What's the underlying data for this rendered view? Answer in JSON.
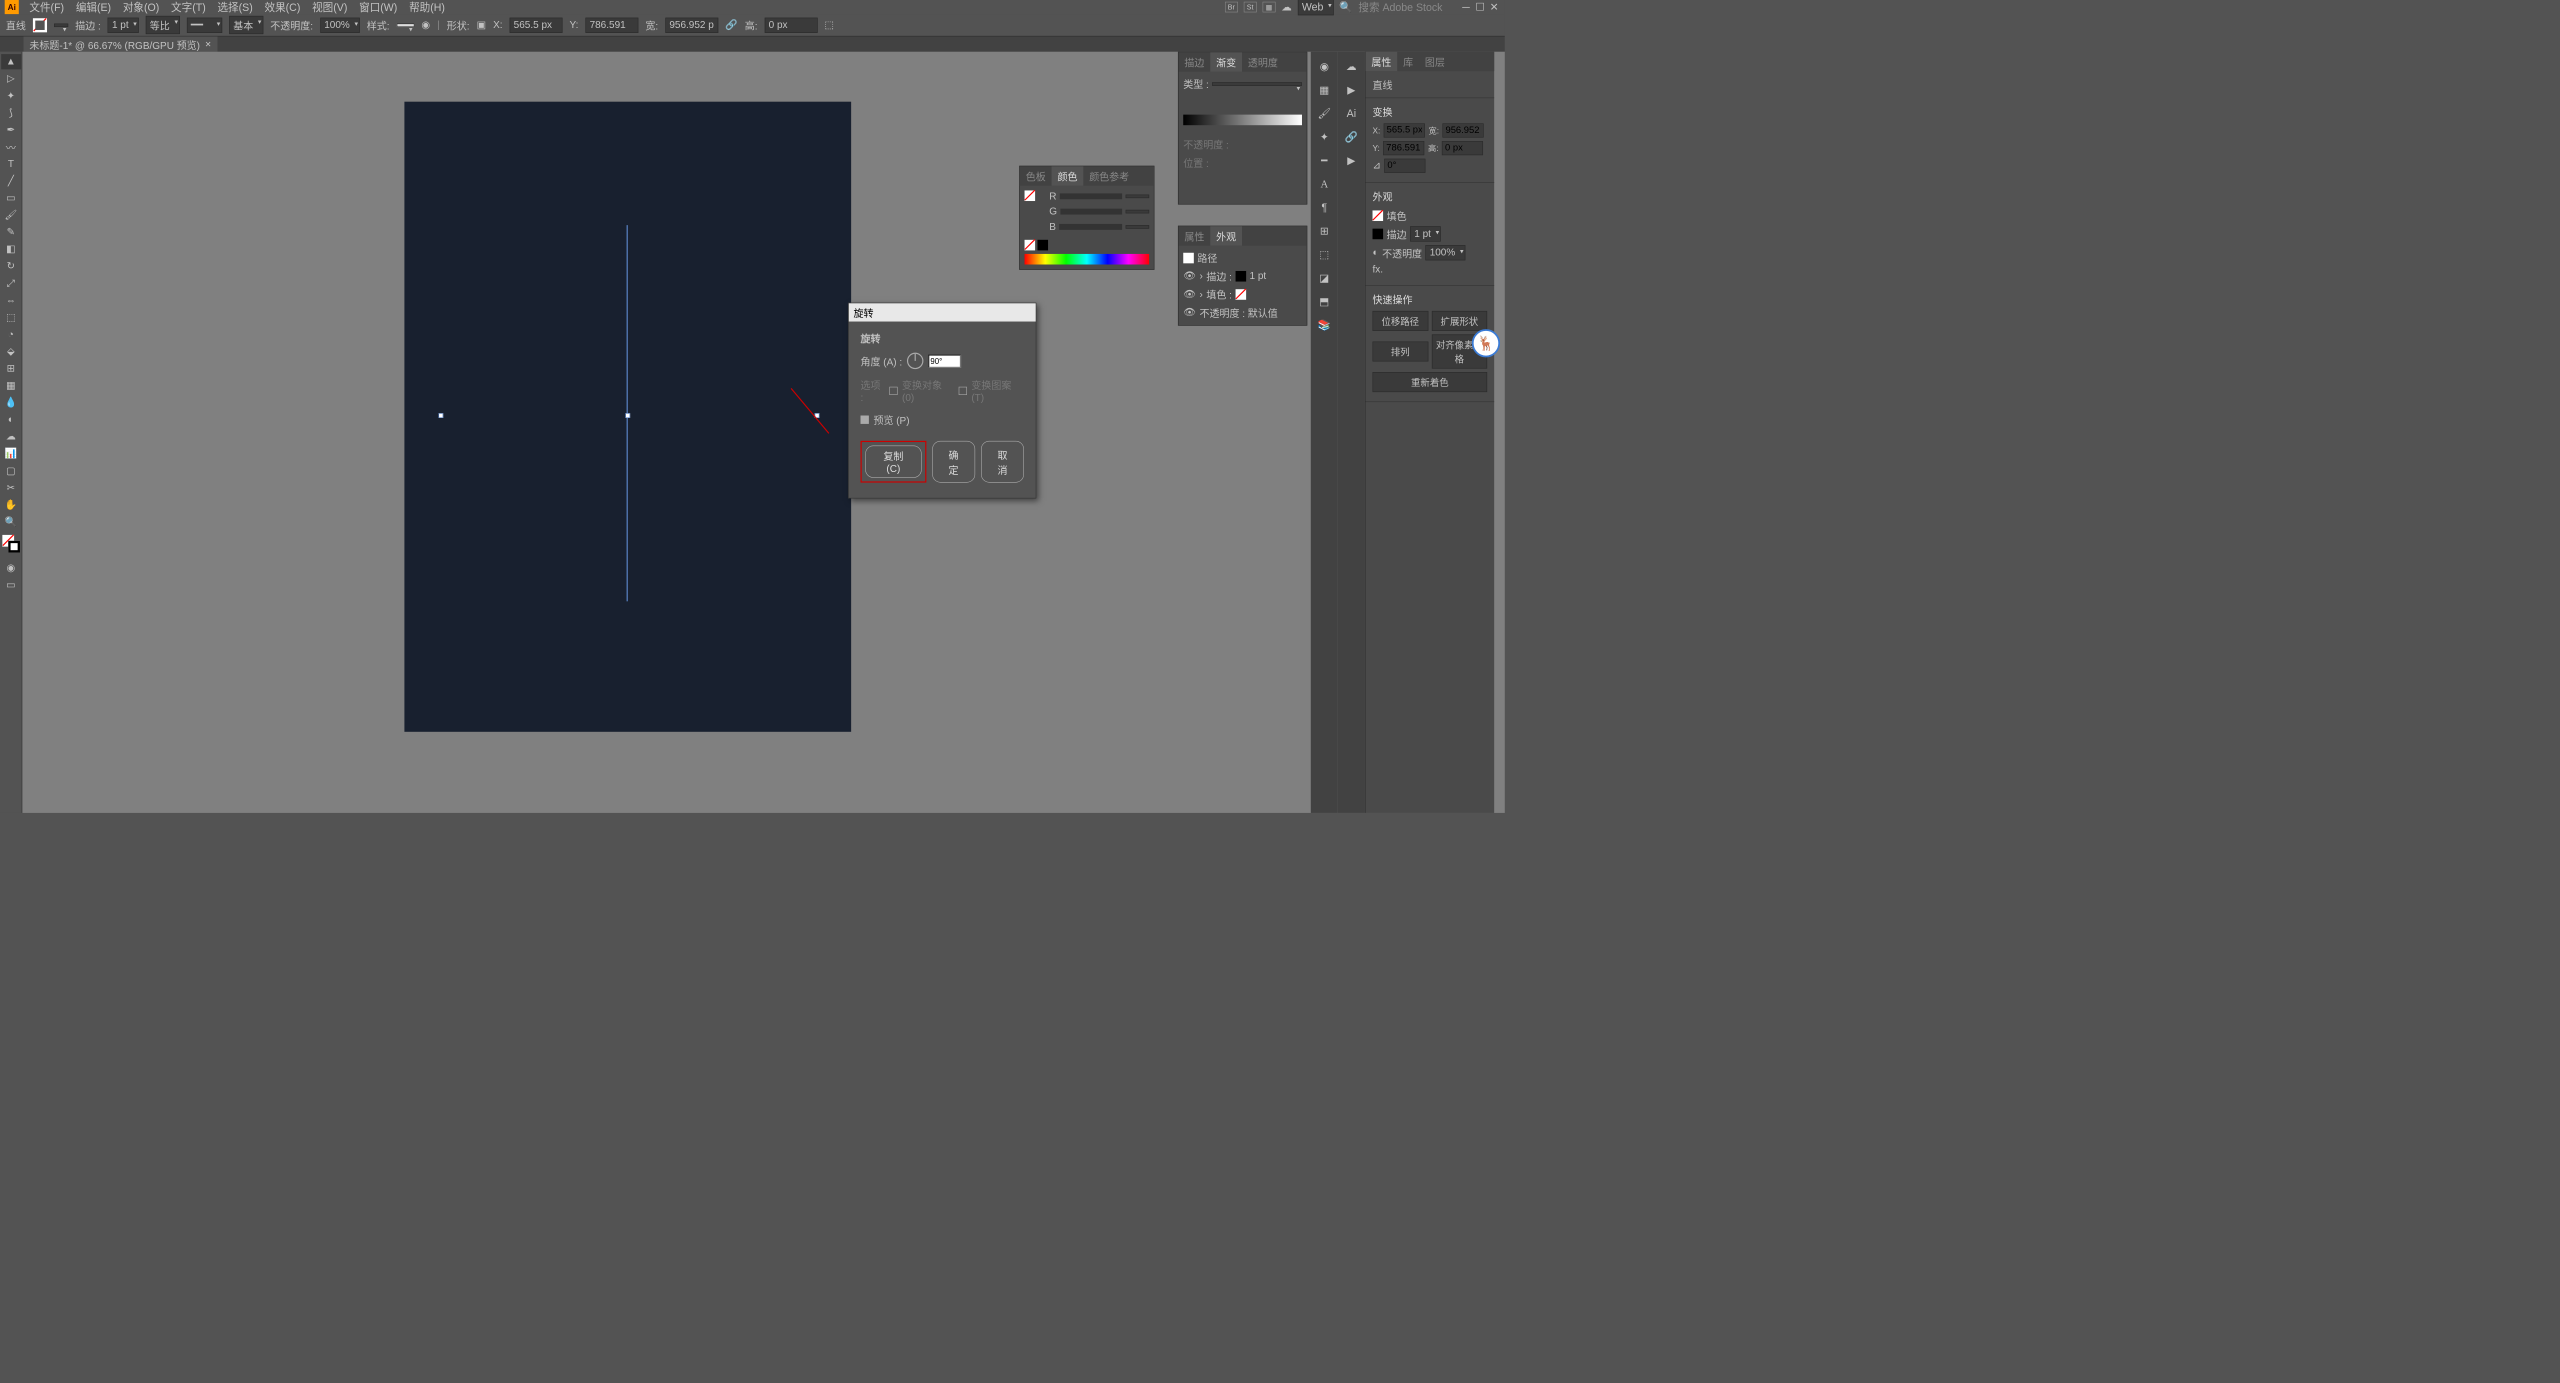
{
  "menu": {
    "items": [
      "文件(F)",
      "编辑(E)",
      "对象(O)",
      "文字(T)",
      "选择(S)",
      "效果(C)",
      "视图(V)",
      "窗口(W)",
      "帮助(H)"
    ],
    "workspace": "Web",
    "search_placeholder": "搜索 Adobe Stock"
  },
  "controlbar": {
    "object": "直线",
    "stroke_val": "",
    "weight": "1 pt",
    "profile": "等比",
    "brush": "基本",
    "opacity_label": "不透明度:",
    "opacity": "100%",
    "style_label": "样式:",
    "shape_label": "形状:",
    "x": "565.5 px",
    "y": "786.591",
    "w": "956.952 p",
    "h": "0 px",
    "x_label": "X:",
    "y_label": "Y:",
    "w_label": "宽:",
    "h_label": "高:"
  },
  "tab": {
    "label": "未标题-1* @ 66.67% (RGB/GPU 预览)"
  },
  "dialog": {
    "title": "旋转",
    "section": "旋转",
    "angle_label": "角度 (A) :",
    "angle_value": "90°",
    "options_label": "选项 :",
    "opt1": "变换对象 (0)",
    "opt2": "变换图案 (T)",
    "preview": "预览 (P)",
    "copy_btn": "复制 (C)",
    "ok_btn": "确定",
    "cancel_btn": "取消"
  },
  "color_panel": {
    "tabs": [
      "色板",
      "颜色",
      "颜色参考"
    ],
    "r_label": "R",
    "g_label": "G",
    "b_label": "B"
  },
  "grad_panel": {
    "tabs": [
      "描边",
      "渐变",
      "透明度"
    ],
    "type_label": "类型 :",
    "opacity_label": "不透明度 :",
    "pos_label": "位置 :"
  },
  "appear_panel": {
    "tabs": [
      "属性",
      "外观"
    ],
    "obj": "路径",
    "stroke_label": "描边 :",
    "stroke_val": "1 pt",
    "fill_label": "填色 :",
    "opacity_label": "不透明度 : 默认值"
  },
  "props": {
    "tabs": [
      "属性",
      "库",
      "图层"
    ],
    "obj": "直线",
    "transform_title": "变换",
    "x": "565.5 px",
    "w": "956.952",
    "y": "786.591",
    "h": "0 px",
    "angle": "0°",
    "appearance_title": "外观",
    "fill_label": "填色",
    "stroke_label": "描边",
    "stroke_val": "1 pt",
    "opacity_label": "不透明度",
    "opacity_val": "100%",
    "quick_title": "快速操作",
    "btn1": "位移路径",
    "btn2": "扩展形状",
    "btn3": "排列",
    "btn4": "对齐像素网格",
    "btn5": "重新着色"
  }
}
